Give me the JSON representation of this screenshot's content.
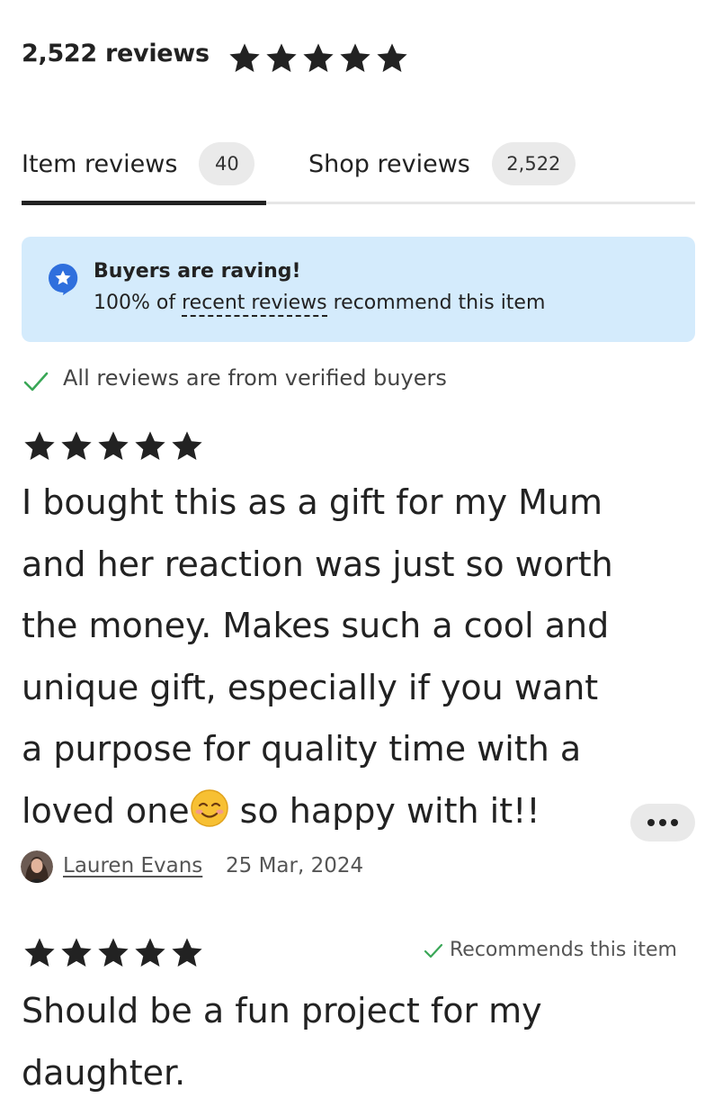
{
  "header": {
    "review_count_label": "2,522 reviews",
    "rating_stars": 5
  },
  "tabs": [
    {
      "label": "Item reviews",
      "count": "40",
      "active": true
    },
    {
      "label": "Shop reviews",
      "count": "2,522",
      "active": false
    }
  ],
  "banner": {
    "title": "Buyers are raving!",
    "text_prefix": "100% of ",
    "link_text": "recent reviews",
    "text_suffix": " recommend this item",
    "background": "#d4ebfc",
    "icon_color": "#2f6fdd",
    "icon": "star-badge-icon"
  },
  "verified": {
    "text": "All reviews are from verified buyers",
    "icon": "check-icon",
    "icon_color": "#3aa757"
  },
  "reviews": [
    {
      "stars": 5,
      "text_lines": [
        "I bought this as a gift for my Mum",
        "and her reaction was just so worth",
        "the money. Makes such a cool and",
        "unique gift, especially if you want",
        "a purpose for quality time with a"
      ],
      "text_last_before_emoji": "loved one",
      "text_last_after_emoji": " so happy with it!!",
      "emoji": "smiling-face-emoji",
      "reviewer": "Lauren Evans",
      "date": "25 Mar, 2024",
      "more_icon": "more-dots-icon"
    },
    {
      "stars": 5,
      "recommends_label": "Recommends this item",
      "text_lines": [
        "Should be a fun project for my",
        "daughter."
      ]
    }
  ]
}
